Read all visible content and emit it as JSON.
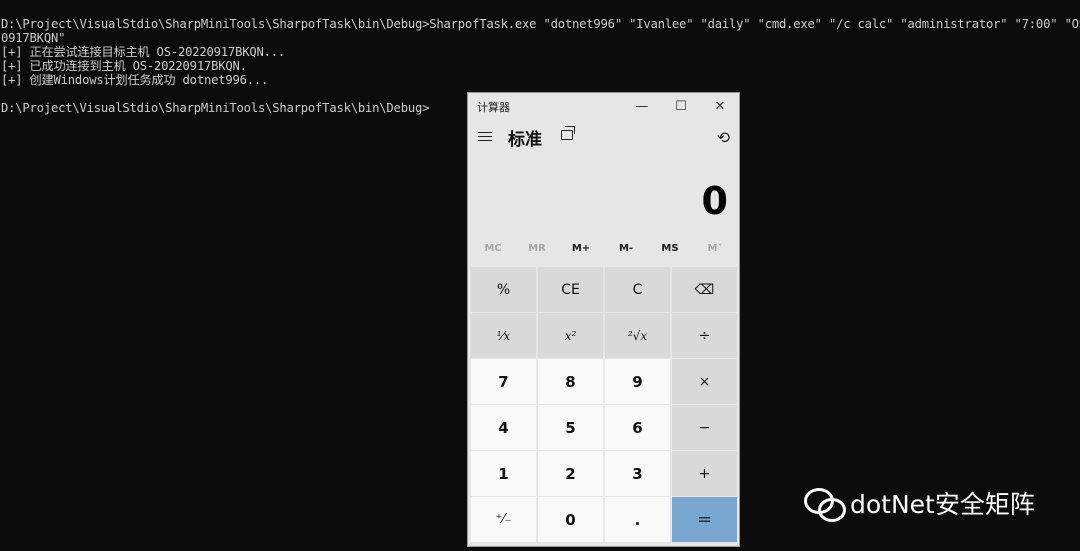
{
  "console": {
    "lines": [
      "D:\\Project\\VisualStdio\\SharpMiniTools\\SharpofTask\\bin\\Debug>SharpofTask.exe \"dotnet996\" \"Ivanlee\" \"daily\" \"cmd.exe\" \"/c calc\" \"administrator\" \"7:00\" \"OS-2022",
      "0917BKQN\"",
      "[+] 正在尝试连接目标主机 OS-20220917BKQN...",
      "[+] 已成功连接到主机 OS-20220917BKQN.",
      "[+] 创建Windows计划任务成功 dotnet996...",
      "",
      "D:\\Project\\VisualStdio\\SharpMiniTools\\SharpofTask\\bin\\Debug>"
    ]
  },
  "calculator": {
    "title": "计算器",
    "mode": "标准",
    "display": "0",
    "memory": [
      {
        "label": "MC",
        "enabled": false
      },
      {
        "label": "MR",
        "enabled": false
      },
      {
        "label": "M+",
        "enabled": true
      },
      {
        "label": "M-",
        "enabled": true
      },
      {
        "label": "MS",
        "enabled": true
      },
      {
        "label": "M˅",
        "enabled": false
      }
    ],
    "keys": [
      [
        "%",
        "CE",
        "C",
        "⌫"
      ],
      [
        "¹⁄x",
        "x²",
        "²√x",
        "÷"
      ],
      [
        "7",
        "8",
        "9",
        "×"
      ],
      [
        "4",
        "5",
        "6",
        "−"
      ],
      [
        "1",
        "2",
        "3",
        "+"
      ],
      [
        "⁺⁄₋",
        "0",
        ".",
        "="
      ]
    ],
    "window_controls": {
      "minimize": "—",
      "maximize": "☐",
      "close": "✕"
    }
  },
  "watermark": {
    "text": "dotNet安全矩阵"
  },
  "colors": {
    "console_bg": "#0c0c0c",
    "console_fg": "#cccccc",
    "equals_key": "#7aa7d0"
  }
}
